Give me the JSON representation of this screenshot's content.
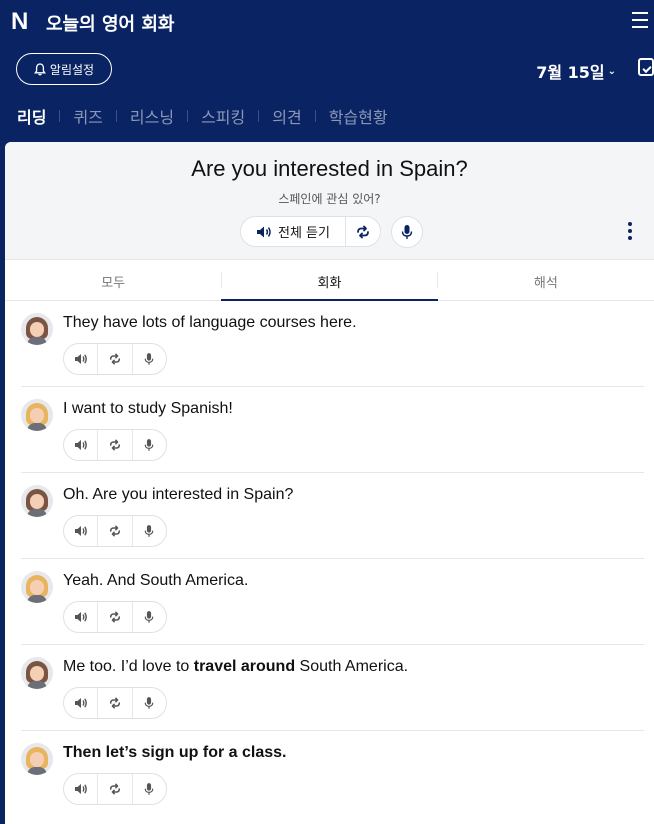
{
  "header": {
    "logo": "N",
    "title": "오늘의 영어 회화",
    "alarm_label": "알림설정",
    "date": "7월 15일"
  },
  "nav": [
    "리딩",
    "퀴즈",
    "리스닝",
    "스피킹",
    "의견",
    "학습현황"
  ],
  "lesson": {
    "title": "Are you interested in Spain?",
    "subtitle": "스페인에 관심 있어?",
    "play_all_label": "전체 듣기"
  },
  "tabs": [
    "모두",
    "회화",
    "해석"
  ],
  "dialogue": [
    {
      "speaker": "dark",
      "parts": [
        {
          "t": "They have lots of language courses here.",
          "b": false
        }
      ]
    },
    {
      "speaker": "blonde",
      "parts": [
        {
          "t": "I want to study Spanish!",
          "b": false
        }
      ]
    },
    {
      "speaker": "dark",
      "parts": [
        {
          "t": "Oh. Are you interested in Spain?",
          "b": false
        }
      ]
    },
    {
      "speaker": "blonde",
      "parts": [
        {
          "t": "Yeah. And South America.",
          "b": false
        }
      ]
    },
    {
      "speaker": "dark",
      "parts": [
        {
          "t": "Me too. I’d love to ",
          "b": false
        },
        {
          "t": "travel around",
          "b": true
        },
        {
          "t": " South America.",
          "b": false
        }
      ]
    },
    {
      "speaker": "blonde",
      "parts": [
        {
          "t": "Then let’s sign up for a class.",
          "b": true
        }
      ]
    }
  ],
  "colors": {
    "brand": "#0a2463",
    "active_tab": "#0a2463"
  },
  "icons": [
    "bell-icon",
    "calendar-icon",
    "menu-icon",
    "speaker-icon",
    "repeat-icon",
    "mic-icon",
    "more-icon"
  ]
}
